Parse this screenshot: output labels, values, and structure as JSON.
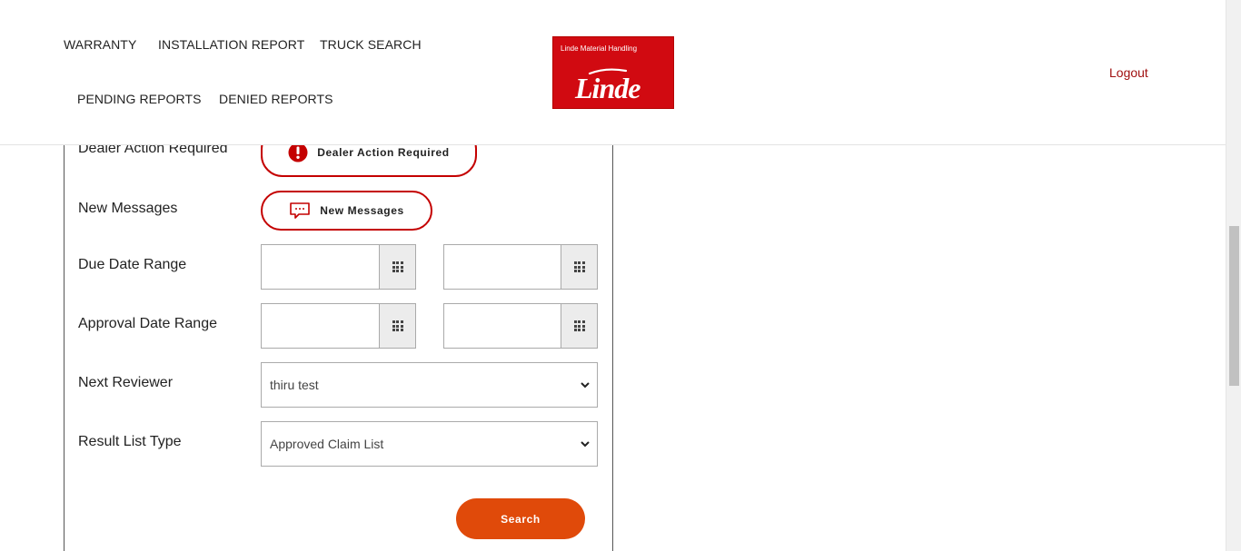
{
  "nav": {
    "warranty": "WARRANTY",
    "installation_report": "INSTALLATION REPORT",
    "truck_search": "TRUCK SEARCH",
    "pending_reports": "PENDING REPORTS",
    "denied_reports": "DENIED REPORTS",
    "logout": "Logout"
  },
  "logo": {
    "small_text": "Linde Material Handling",
    "wordmark": "Linde"
  },
  "form": {
    "dealer_action": {
      "label": "Dealer Action Required",
      "button_label": "Dealer Action Required",
      "icon": "exclamation-icon"
    },
    "new_messages": {
      "label": "New Messages",
      "button_label": "New Messages",
      "icon": "message-icon"
    },
    "due_date_range": {
      "label": "Due Date Range",
      "from_value": "",
      "to_value": ""
    },
    "approval_date_range": {
      "label": "Approval Date Range",
      "from_value": "",
      "to_value": ""
    },
    "next_reviewer": {
      "label": "Next Reviewer",
      "selected": "thiru test"
    },
    "result_list_type": {
      "label": "Result List Type",
      "selected": "Approved Claim List"
    },
    "search_label": "Search"
  },
  "colors": {
    "brand_red": "#d10a11",
    "accent_border": "#c40000",
    "search_button": "#e04a0a",
    "logout_text": "#a01010"
  }
}
